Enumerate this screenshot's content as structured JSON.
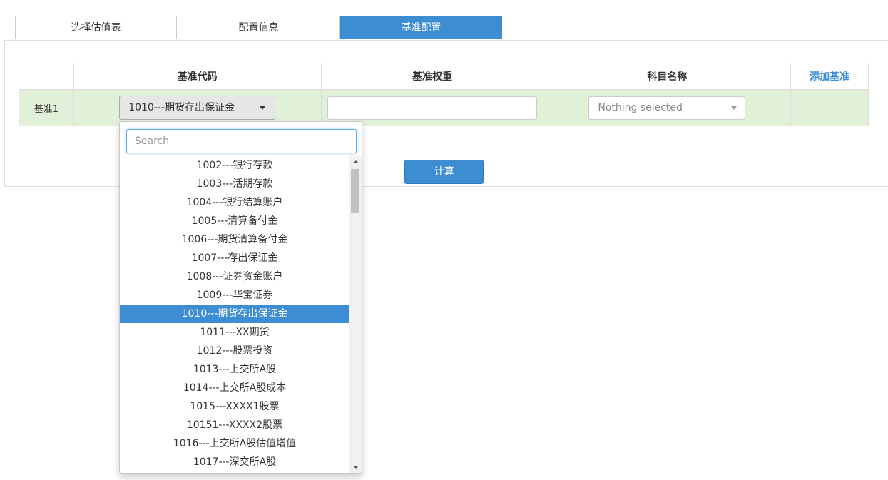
{
  "tabs": [
    {
      "label": "选择估值表",
      "active": false
    },
    {
      "label": "配置信息",
      "active": false
    },
    {
      "label": "基准配置",
      "active": true
    }
  ],
  "table": {
    "headers": {
      "code": "基准代码",
      "weight": "基准权重",
      "subject": "科目名称",
      "add": "添加基准"
    },
    "rows": [
      {
        "label": "基准1",
        "code_selected": "1010---期货存出保证金",
        "weight_value": "",
        "subject_placeholder": "Nothing selected"
      }
    ]
  },
  "calc_button": "计算",
  "dropdown": {
    "search_placeholder": "Search",
    "options": [
      "1002---银行存款",
      "1003---活期存款",
      "1004---银行结算账户",
      "1005---清算备付金",
      "1006---期货清算备付金",
      "1007---存出保证金",
      "1008---证券资金账户",
      "1009---华宝证券",
      "1010---期货存出保证金",
      "1011---XX期货",
      "1012---股票投资",
      "1013---上交所A股",
      "1014---上交所A股成本",
      "1015---XXXX1股票",
      "10151---XXXX2股票",
      "1016---上交所A股估值增值",
      "1017---深交所A股"
    ],
    "selected_option": "1010---期货存出保证金"
  },
  "colors": {
    "accent": "#3c8dd2",
    "row_bg": "#e2f0d9"
  }
}
